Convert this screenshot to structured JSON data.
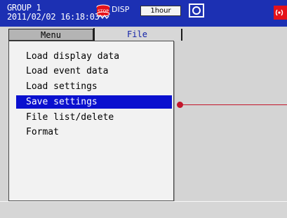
{
  "header": {
    "group": "GROUP 1",
    "datetime": "2011/02/02 16:18:03",
    "stop_icon": "stop-recording-icon",
    "disp_label": "DISP",
    "time_div": "1hour",
    "media_icon": "media-icon",
    "alarm_icon": "alarm-icon",
    "colors": {
      "header_bg": "#1c30b3",
      "alarm": "#e5121a"
    }
  },
  "tabs": [
    {
      "label": "Menu"
    },
    {
      "label": "File"
    }
  ],
  "menu": {
    "items": [
      {
        "label": "Load display data"
      },
      {
        "label": "Load event data"
      },
      {
        "label": "Load settings"
      },
      {
        "label": "Save settings"
      },
      {
        "label": "File list/delete"
      },
      {
        "label": "Format"
      }
    ],
    "selected_index": 3,
    "selected_color": "#0a10cf"
  },
  "pointer": {
    "color": "#c2162b"
  }
}
